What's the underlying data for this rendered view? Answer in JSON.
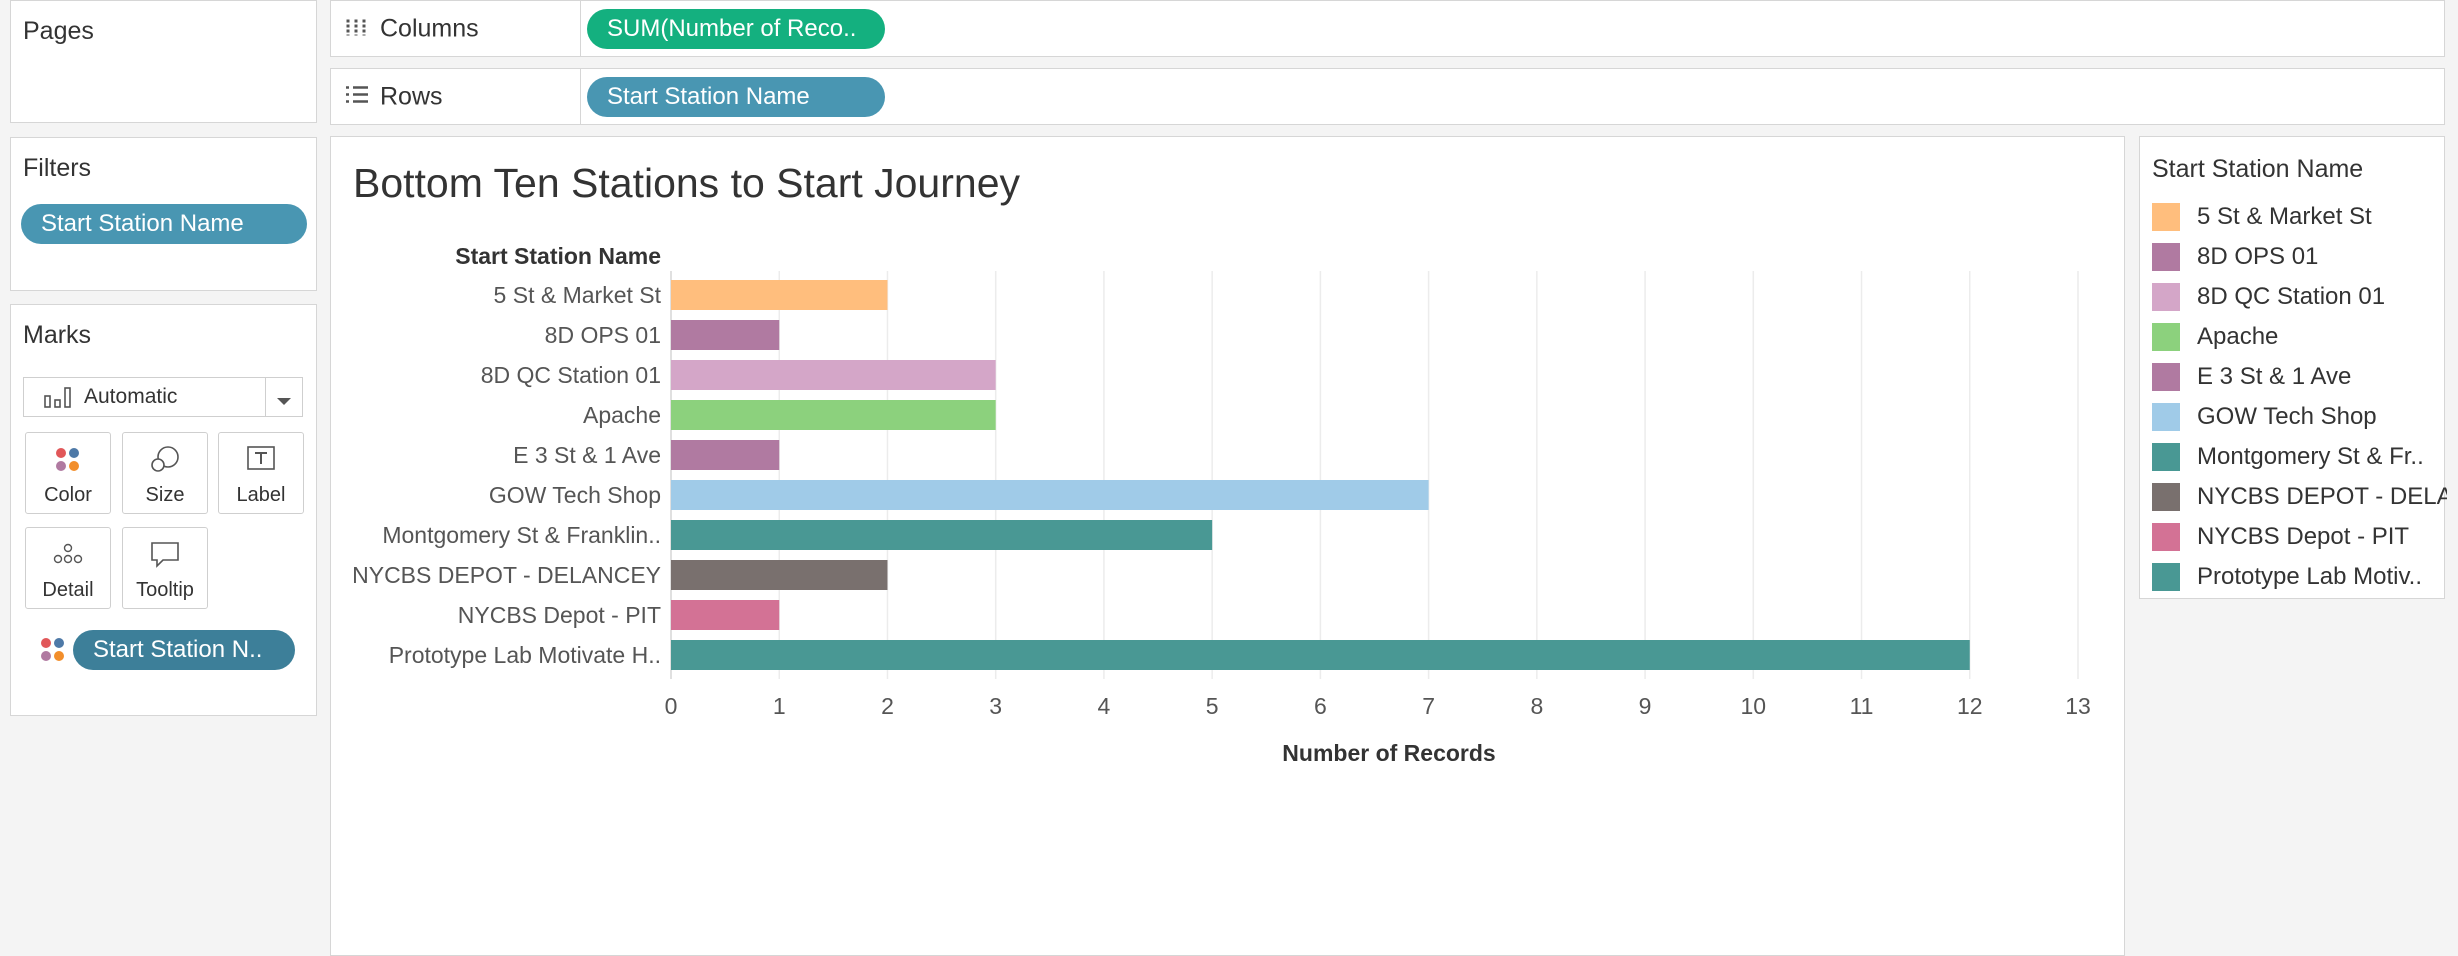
{
  "pages": {
    "title": "Pages"
  },
  "filters": {
    "title": "Filters",
    "pill": "Start Station Name"
  },
  "marks": {
    "title": "Marks",
    "dropdown": "Automatic",
    "buttons": {
      "color": "Color",
      "size": "Size",
      "label": "Label",
      "detail": "Detail",
      "tooltip": "Tooltip"
    },
    "color_pill": "Start Station N.."
  },
  "shelves": {
    "columns_label": "Columns",
    "columns_pill": "SUM(Number of Reco..",
    "rows_label": "Rows",
    "rows_pill": "Start Station Name"
  },
  "legend": {
    "title": "Start Station Name",
    "items": [
      {
        "label": "5 St & Market St",
        "color": "#ffbe7d"
      },
      {
        "label": "8D OPS 01",
        "color": "#b07aa1"
      },
      {
        "label": "8D QC Station 01",
        "color": "#d4a6c8"
      },
      {
        "label": "Apache",
        "color": "#8cd17d"
      },
      {
        "label": "E 3 St & 1 Ave",
        "color": "#b07aa1"
      },
      {
        "label": "GOW Tech Shop",
        "color": "#a0cbe8"
      },
      {
        "label": "Montgomery St & Fr..",
        "color": "#499894"
      },
      {
        "label": "NYCBS DEPOT - DELA..",
        "color": "#79706e"
      },
      {
        "label": "NYCBS Depot - PIT",
        "color": "#d37295"
      },
      {
        "label": "Prototype Lab Motiv..",
        "color": "#499894"
      }
    ]
  },
  "chart_data": {
    "type": "bar",
    "orientation": "horizontal",
    "title": "Bottom Ten Stations to Start Journey",
    "row_header": "Start Station Name",
    "xlabel": "Number of Records",
    "categories": [
      "5 St & Market St",
      "8D OPS 01",
      "8D QC Station 01",
      "Apache",
      "E 3 St & 1 Ave",
      "GOW Tech Shop",
      "Montgomery St & Franklin..",
      "NYCBS DEPOT - DELANCEY",
      "NYCBS Depot - PIT",
      "Prototype Lab Motivate H.."
    ],
    "values": [
      2,
      1,
      3,
      3,
      1,
      7,
      5,
      2,
      1,
      12
    ],
    "colors": [
      "#ffbe7d",
      "#b07aa1",
      "#d4a6c8",
      "#8cd17d",
      "#b07aa1",
      "#a0cbe8",
      "#499894",
      "#79706e",
      "#d37295",
      "#499894"
    ],
    "xlim": [
      0,
      13
    ],
    "xticks": [
      "0",
      "1",
      "2",
      "3",
      "4",
      "5",
      "6",
      "7",
      "8",
      "9",
      "10",
      "11",
      "12",
      "13"
    ],
    "grid": true
  }
}
